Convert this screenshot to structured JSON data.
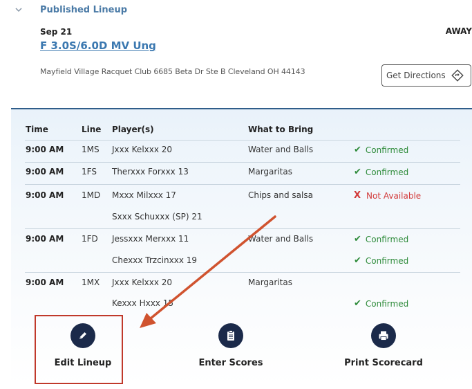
{
  "header": {
    "section_title": "Published Lineup",
    "date": "Sep 21",
    "match_name": "F 3.0S/6.0D MV Ung",
    "home_away": "AWAY",
    "address": "Mayfield Village Racquet Club 6685 Beta Dr Ste B Cleveland OH 44143",
    "directions_label": "Get Directions",
    "directions_icon": "directions-diamond-icon"
  },
  "table": {
    "headers": [
      "Time",
      "Line",
      "Player(s)",
      "What to Bring"
    ],
    "rows": [
      {
        "time": "9:00 AM",
        "line": "1MS",
        "player": "Jxxx Kelxxx 20",
        "bring": "Water and Balls",
        "status": "Confirmed"
      },
      {
        "time": "9:00 AM",
        "line": "1FS",
        "player": "Therxxx Forxxx 13",
        "bring": "Margaritas",
        "status": "Confirmed"
      },
      {
        "time": "9:00 AM",
        "line": "1MD",
        "player": "Mxxx Milxxx 17",
        "bring": "Chips and salsa",
        "status": "Not Available"
      },
      {
        "time": "",
        "line": "",
        "player": "Sxxx Schuxxx (SP) 21",
        "bring": "",
        "status": ""
      },
      {
        "time": "9:00 AM",
        "line": "1FD",
        "player": "Jessxxx Merxxx 11",
        "bring": "Water and Balls",
        "status": "Confirmed"
      },
      {
        "time": "",
        "line": "",
        "player": "Chexxx Trzcinxxx 19",
        "bring": "",
        "status": "Confirmed"
      },
      {
        "time": "9:00 AM",
        "line": "1MX",
        "player": "Jxxx Kelxxx 20",
        "bring": "Margaritas",
        "status": ""
      },
      {
        "time": "",
        "line": "",
        "player": "Kexxx Hxxx 15",
        "bring": "",
        "status": "Confirmed"
      }
    ],
    "status_icons": {
      "confirmed": "✔",
      "not_available": "X"
    },
    "colors": {
      "confirmed": "#2e8b3a",
      "not_available": "#d23b3b"
    }
  },
  "actions": {
    "edit": {
      "label": "Edit Lineup",
      "icon": "pencil-icon"
    },
    "scores": {
      "label": "Enter Scores",
      "icon": "clipboard-icon"
    },
    "print": {
      "label": "Print Scorecard",
      "icon": "printer-icon"
    }
  },
  "annotation": {
    "highlight_color": "#c0392b",
    "arrow_color": "#d0532f"
  }
}
